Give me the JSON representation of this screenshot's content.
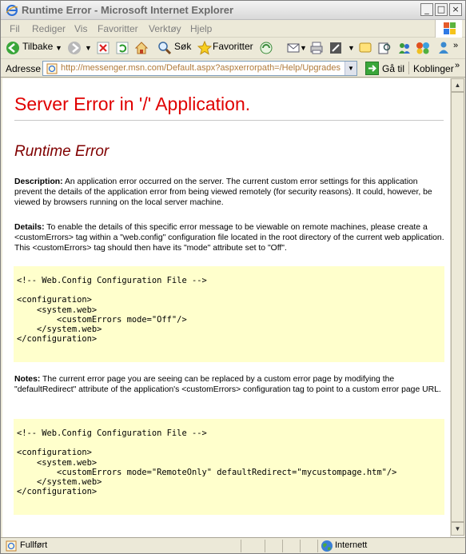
{
  "window": {
    "title": "Runtime Error - Microsoft Internet Explorer",
    "buttons": {
      "minimize": "_",
      "maximize": "□",
      "close": "×"
    }
  },
  "menu": [
    "Fil",
    "Rediger",
    "Vis",
    "Favoritter",
    "Verktøy",
    "Hjelp"
  ],
  "toolbar": {
    "back_label": "Tilbake",
    "search_label": "Søk",
    "favorites_label": "Favoritter"
  },
  "address": {
    "label": "Adresse",
    "url": "http://messenger.msn.com/Default.aspx?aspxerrorpath=/Help/Upgrades.a",
    "go_label": "Gå til",
    "links_label": "Koblinger"
  },
  "page": {
    "heading": "Server Error in '/' Application.",
    "subheading": "Runtime Error",
    "description_label": "Description:",
    "description_text": " An application error occurred on the server. The current custom error settings for this application prevent the details of the application error from being viewed remotely (for security reasons). It could, however, be viewed by browsers running on the local server machine.",
    "details_label": "Details:",
    "details_text": " To enable the details of this specific error message to be viewable on remote machines, please create a <customErrors> tag within a \"web.config\" configuration file located in the root directory of the current web application. This <customErrors> tag should then have its \"mode\" attribute set to \"Off\".",
    "code1": "<!-- Web.Config Configuration File -->\n\n<configuration>\n    <system.web>\n        <customErrors mode=\"Off\"/>\n    </system.web>\n</configuration>",
    "notes_label": "Notes:",
    "notes_text": " The current error page you are seeing can be replaced by a custom error page by modifying the \"defaultRedirect\" attribute of the application's <customErrors> configuration tag to point to a custom error page URL.",
    "code2": "<!-- Web.Config Configuration File -->\n\n<configuration>\n    <system.web>\n        <customErrors mode=\"RemoteOnly\" defaultRedirect=\"mycustompage.htm\"/>\n    </system.web>\n</configuration>"
  },
  "status": {
    "text": "Fullført",
    "zone": "Internett"
  },
  "colors": {
    "heading": "#e00000",
    "subheading": "#800000",
    "code_background": "#ffffcc",
    "url_text": "#b07a3a"
  }
}
